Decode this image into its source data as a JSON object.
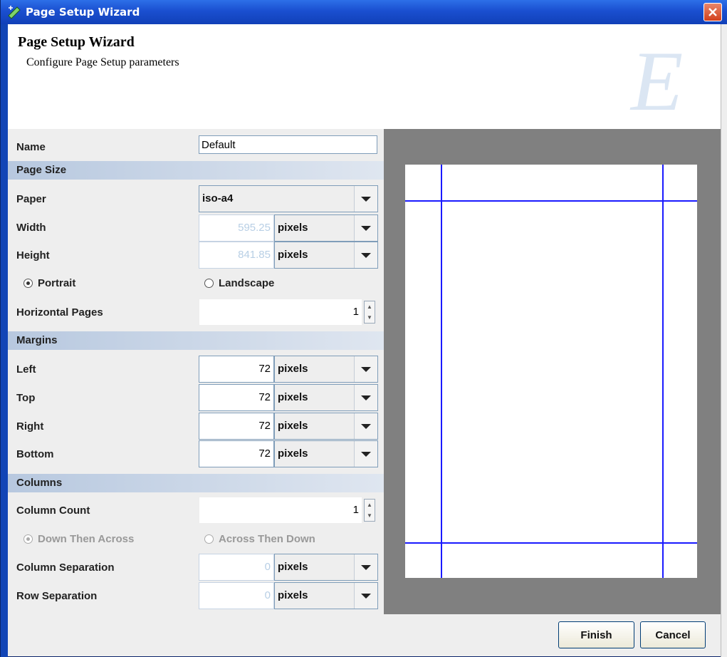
{
  "window": {
    "title": "Page Setup Wizard"
  },
  "header": {
    "title": "Page Setup Wizard",
    "subtitle": "Configure Page Setup parameters",
    "logo_letter": "E"
  },
  "form": {
    "name_label": "Name",
    "name_value": "Default",
    "page_size_section": "Page Size",
    "paper_label": "Paper",
    "paper_value": "iso-a4",
    "width_label": "Width",
    "width_value": "595.25",
    "width_unit": "pixels",
    "height_label": "Height",
    "height_value": "841.85",
    "height_unit": "pixels",
    "orientation": {
      "portrait": "Portrait",
      "landscape": "Landscape",
      "selected": "Portrait"
    },
    "horizontal_pages_label": "Horizontal Pages",
    "horizontal_pages_value": "1",
    "margins_section": "Margins",
    "left_label": "Left",
    "left_value": "72",
    "left_unit": "pixels",
    "top_label": "Top",
    "top_value": "72",
    "top_unit": "pixels",
    "right_label": "Right",
    "right_value": "72",
    "right_unit": "pixels",
    "bottom_label": "Bottom",
    "bottom_value": "72",
    "bottom_unit": "pixels",
    "columns_section": "Columns",
    "column_count_label": "Column Count",
    "column_count_value": "1",
    "order": {
      "down_then_across": "Down Then Across",
      "across_then_down": "Across Then Down",
      "selected": "Down Then Across"
    },
    "column_separation_label": "Column Separation",
    "column_separation_value": "0",
    "column_separation_unit": "pixels",
    "row_separation_label": "Row Separation",
    "row_separation_value": "0",
    "row_separation_unit": "pixels"
  },
  "buttons": {
    "finish": "Finish",
    "cancel": "Cancel"
  },
  "colors": {
    "margin_line": "#1a1aff",
    "preview_bg": "#808080",
    "titlebar": "#1a4fd0"
  }
}
